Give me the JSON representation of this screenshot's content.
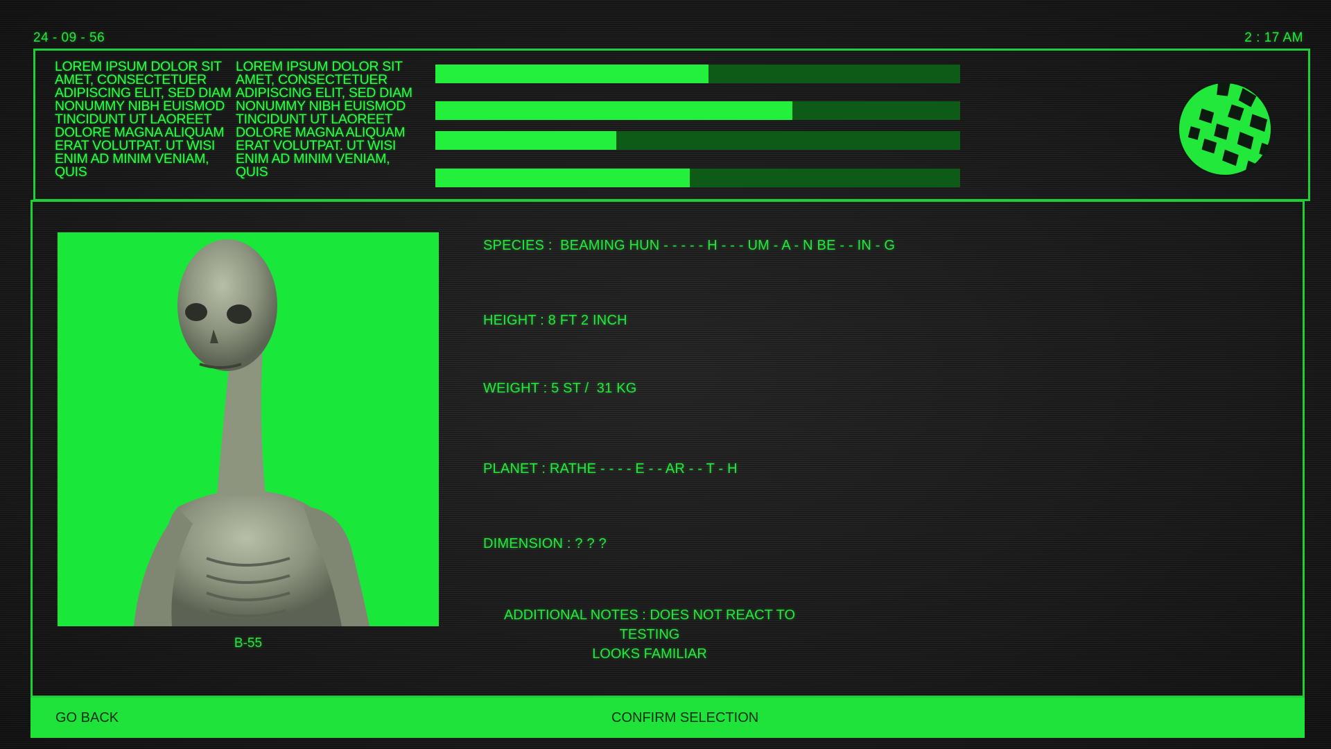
{
  "header": {
    "date": "24 - 09 - 56",
    "time": "2 : 17 AM"
  },
  "top_panel": {
    "lorem_left": "LOREM IPSUM DOLOR SIT AMET, CONSECTETUER ADIPISCING ELIT, SED DIAM NONUMMY NIBH EUISMOD TINCIDUNT UT LAOREET DOLORE MAGNA ALIQUAM ERAT VOLUTPAT. UT WISI ENIM AD MINIM VENIAM, QUIS",
    "lorem_right": "LOREM IPSUM DOLOR SIT AMET, CONSECTETUER ADIPISCING ELIT, SED DIAM NONUMMY NIBH EUISMOD TINCIDUNT UT LAOREET DOLORE MAGNA ALIQUAM ERAT VOLUTPAT. UT WISI ENIM AD MINIM VENIAM, QUIS",
    "bars": [
      0.52,
      0.68,
      0.345,
      0.485
    ],
    "globe_icon": "globe-icon"
  },
  "subject": {
    "caption": "B-55",
    "species": "SPECIES :  BEAMING HUN - - - - - H - - - UM - A - N BE - - IN - G",
    "height": "HEIGHT : 8 FT 2 INCH",
    "weight": "WEIGHT : 5 ST /  31 KG",
    "planet": "PLANET : RATHE - - - - E - - AR - - T - H",
    "dimension": "DIMENSION : ? ? ?",
    "notes_line1": "ADDITIONAL NOTES : DOES NOT REACT TO TESTING",
    "notes_line2": "LOOKS FAMILIAR"
  },
  "footer": {
    "go_back_label": "GO BACK",
    "confirm_label": "CONFIRM SELECTION"
  },
  "colors": {
    "accent": "#27e63d",
    "bar_track": "#0e5a17",
    "background": "#1e1e1e"
  }
}
